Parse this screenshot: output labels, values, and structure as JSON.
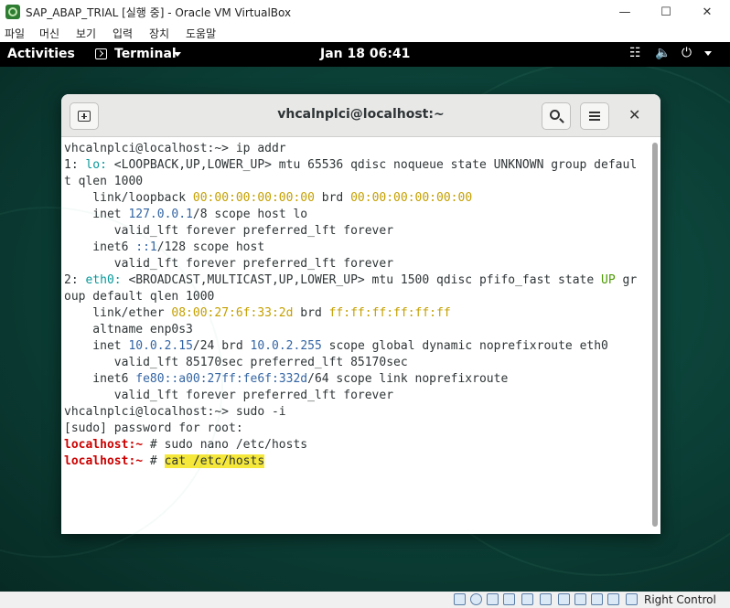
{
  "vbox": {
    "title": "SAP_ABAP_TRIAL [실행 중] - Oracle VM VirtualBox",
    "menu": [
      "파일",
      "머신",
      "보기",
      "입력",
      "장치",
      "도움말"
    ],
    "host_key": "Right Control"
  },
  "gnome": {
    "activities": "Activities",
    "app_name": "Terminal",
    "clock": "Jan 18  06:41"
  },
  "terminal": {
    "title": "vhcalnplci@localhost:~",
    "lines": [
      [
        {
          "t": "vhcalnplci@localhost:~> ip addr"
        }
      ],
      [
        {
          "t": "1: "
        },
        {
          "t": "lo:",
          "c": "cyan"
        },
        {
          "t": " <LOOPBACK,UP,LOWER_UP> mtu 65536 qdisc noqueue state UNKNOWN group defaul"
        }
      ],
      [
        {
          "t": "t qlen 1000"
        }
      ],
      [
        {
          "t": "    link/loopback "
        },
        {
          "t": "00:00:00:00:00:00",
          "c": "yellow"
        },
        {
          "t": " brd "
        },
        {
          "t": "00:00:00:00:00:00",
          "c": "yellow"
        }
      ],
      [
        {
          "t": "    inet "
        },
        {
          "t": "127.0.0.1",
          "c": "blue"
        },
        {
          "t": "/8 scope host lo"
        }
      ],
      [
        {
          "t": "       valid_lft forever preferred_lft forever"
        }
      ],
      [
        {
          "t": "    inet6 "
        },
        {
          "t": "::1",
          "c": "blue"
        },
        {
          "t": "/128 scope host"
        }
      ],
      [
        {
          "t": "       valid_lft forever preferred_lft forever"
        }
      ],
      [
        {
          "t": "2: "
        },
        {
          "t": "eth0:",
          "c": "cyan"
        },
        {
          "t": " <BROADCAST,MULTICAST,UP,LOWER_UP> mtu 1500 qdisc pfifo_fast state "
        },
        {
          "t": "UP",
          "c": "green"
        },
        {
          "t": " gr"
        }
      ],
      [
        {
          "t": "oup default qlen 1000"
        }
      ],
      [
        {
          "t": "    link/ether "
        },
        {
          "t": "08:00:27:6f:33:2d",
          "c": "yellow"
        },
        {
          "t": " brd "
        },
        {
          "t": "ff:ff:ff:ff:ff:ff",
          "c": "yellow"
        }
      ],
      [
        {
          "t": "    altname enp0s3"
        }
      ],
      [
        {
          "t": "    inet "
        },
        {
          "t": "10.0.2.15",
          "c": "blue"
        },
        {
          "t": "/24 brd "
        },
        {
          "t": "10.0.2.255",
          "c": "blue"
        },
        {
          "t": " scope global dynamic noprefixroute eth0"
        }
      ],
      [
        {
          "t": "       valid_lft 85170sec preferred_lft 85170sec"
        }
      ],
      [
        {
          "t": "    inet6 "
        },
        {
          "t": "fe80::a00:27ff:fe6f:332d",
          "c": "blue"
        },
        {
          "t": "/64 scope link noprefixroute"
        }
      ],
      [
        {
          "t": "       valid_lft forever preferred_lft forever"
        }
      ],
      [
        {
          "t": "vhcalnplci@localhost:~> sudo -i"
        }
      ],
      [
        {
          "t": "[sudo] password for root:"
        }
      ],
      [
        {
          "t": "localhost:~",
          "c": "red"
        },
        {
          "t": " # sudo nano /etc/hosts"
        }
      ],
      [
        {
          "t": "localhost:~",
          "c": "red"
        },
        {
          "t": " # "
        },
        {
          "t": "cat /etc/hosts",
          "c": "hl"
        }
      ]
    ]
  }
}
